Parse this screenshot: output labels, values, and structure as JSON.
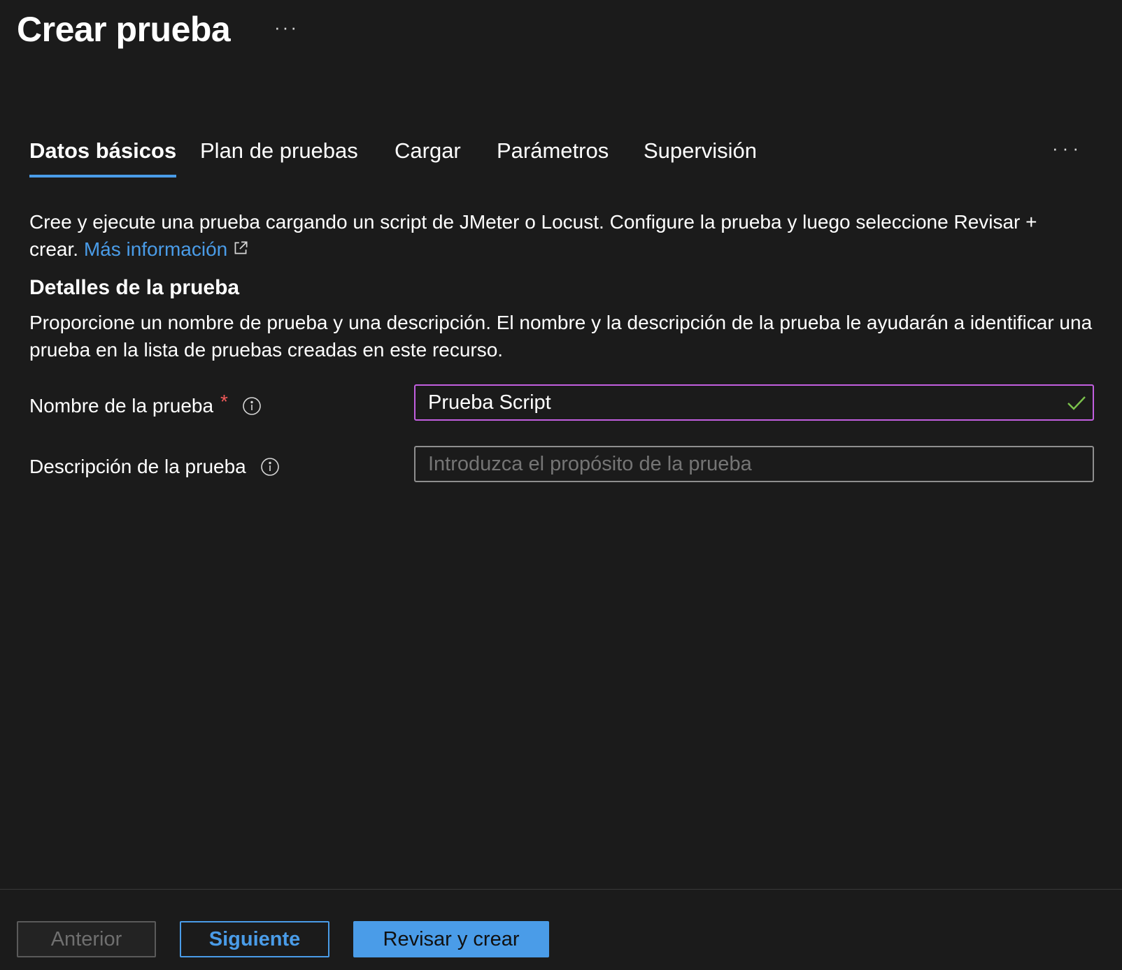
{
  "page": {
    "title": "Crear prueba",
    "title_more": "···"
  },
  "tabs": [
    {
      "label": "Datos básicos",
      "active": true
    },
    {
      "label": "Plan de pruebas",
      "active": false
    },
    {
      "label": "Cargar",
      "active": false
    },
    {
      "label": "Parámetros",
      "active": false
    },
    {
      "label": "Supervisión",
      "active": false
    }
  ],
  "tabs_more": "···",
  "intro": {
    "text": "Cree y ejecute una prueba cargando un script de JMeter o Locust. Configure la prueba y luego seleccione Revisar + crear.",
    "link_label": "Más información",
    "link_icon": "external-link-icon"
  },
  "section": {
    "title": "Detalles de la prueba",
    "description": "Proporcione un nombre de prueba y una descripción. El nombre y la descripción de la prueba le ayudarán a identificar una prueba en la lista de pruebas creadas en este recurso."
  },
  "fields": {
    "name": {
      "label": "Nombre de la prueba",
      "required_marker": "*",
      "value": "Prueba Script",
      "info_icon": "info-icon",
      "valid_icon": "checkmark-icon"
    },
    "description": {
      "label": "Descripción de la prueba",
      "value": "",
      "placeholder": "Introduzca el propósito de la prueba",
      "info_icon": "info-icon"
    }
  },
  "footer": {
    "prev_label": "Anterior",
    "next_label": "Siguiente",
    "create_label": "Revisar y crear"
  },
  "colors": {
    "background": "#1b1b1b",
    "accent": "#4a9ce8",
    "focus_border": "#c25fe0",
    "required": "#f25a5a",
    "valid": "#7bc24c"
  }
}
